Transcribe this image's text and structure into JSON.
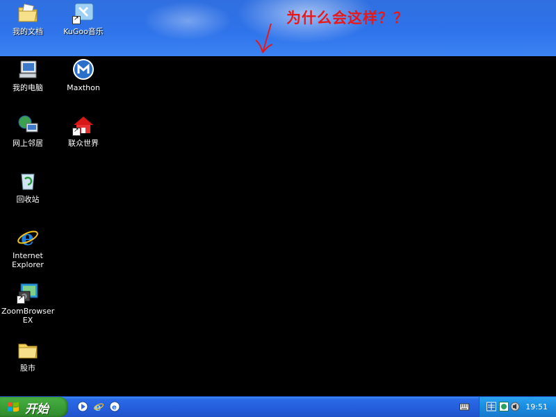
{
  "annotation": {
    "text": "为什么会这样？？"
  },
  "desktop": {
    "icons": [
      {
        "id": "my-documents",
        "label": "我的文档"
      },
      {
        "id": "kugoo",
        "label": "KuGoo音乐"
      },
      {
        "id": "my-computer",
        "label": "我的电脑"
      },
      {
        "id": "maxthon",
        "label": "Maxthon"
      },
      {
        "id": "network",
        "label": "网上邻居"
      },
      {
        "id": "lianzhong",
        "label": "联众世界"
      },
      {
        "id": "recycle-bin",
        "label": "回收站"
      },
      {
        "id": "ie",
        "label": "Internet Explorer"
      },
      {
        "id": "zoombrowser",
        "label": "ZoomBrowser EX"
      },
      {
        "id": "stocks",
        "label": "股市"
      }
    ]
  },
  "taskbar": {
    "start_label": "开始",
    "clock": "19:51",
    "quick_launch": [
      "media-player-icon",
      "ie-icon",
      "browser-icon"
    ]
  },
  "colors": {
    "annotation": "#e81818",
    "taskbar": "#245ddb",
    "start": "#3a9e36"
  }
}
